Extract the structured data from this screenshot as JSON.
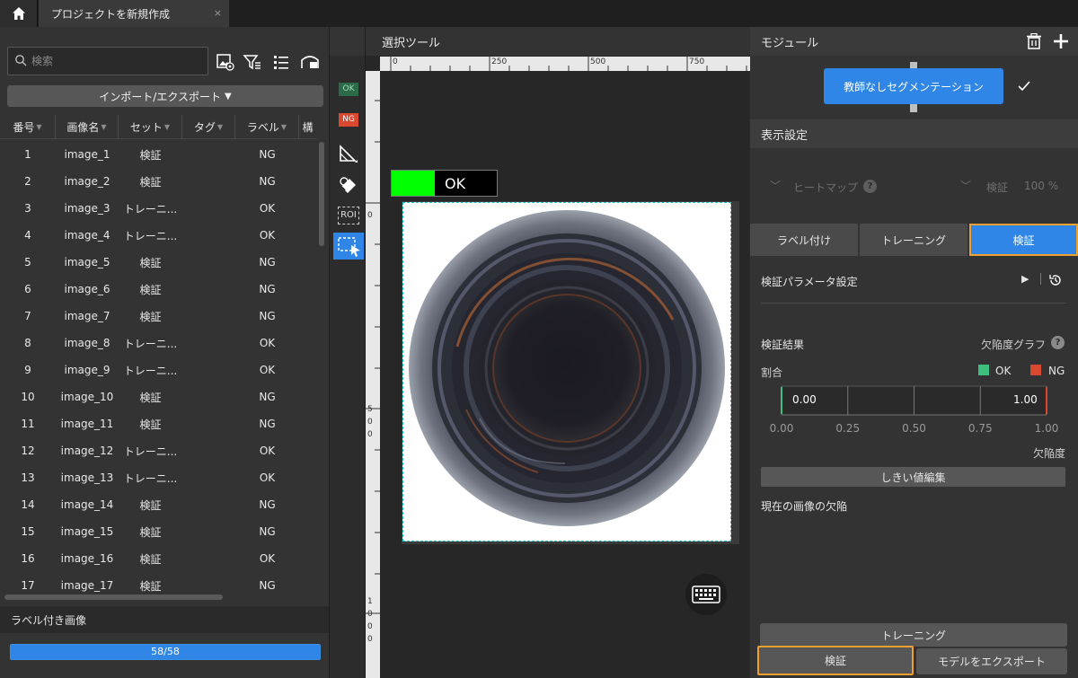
{
  "tab": {
    "title": "プロジェクトを新規作成",
    "close": "×"
  },
  "left": {
    "search_placeholder": "検索",
    "import_label": "インポート/エクスポート",
    "columns": [
      "番号",
      "画像名",
      "セット",
      "タグ",
      "ラベル",
      "構"
    ],
    "rows": [
      {
        "no": "1",
        "name": "image_1",
        "set": "検証",
        "tag": "",
        "label": "NG"
      },
      {
        "no": "2",
        "name": "image_2",
        "set": "検証",
        "tag": "",
        "label": "NG"
      },
      {
        "no": "3",
        "name": "image_3",
        "set": "トレーニ...",
        "tag": "",
        "label": "OK"
      },
      {
        "no": "4",
        "name": "image_4",
        "set": "トレーニ...",
        "tag": "",
        "label": "OK"
      },
      {
        "no": "5",
        "name": "image_5",
        "set": "検証",
        "tag": "",
        "label": "NG"
      },
      {
        "no": "6",
        "name": "image_6",
        "set": "検証",
        "tag": "",
        "label": "NG"
      },
      {
        "no": "7",
        "name": "image_7",
        "set": "検証",
        "tag": "",
        "label": "NG"
      },
      {
        "no": "8",
        "name": "image_8",
        "set": "トレーニ...",
        "tag": "",
        "label": "OK"
      },
      {
        "no": "9",
        "name": "image_9",
        "set": "トレーニ...",
        "tag": "",
        "label": "OK"
      },
      {
        "no": "10",
        "name": "image_10",
        "set": "検証",
        "tag": "",
        "label": "NG"
      },
      {
        "no": "11",
        "name": "image_11",
        "set": "検証",
        "tag": "",
        "label": "NG"
      },
      {
        "no": "12",
        "name": "image_12",
        "set": "トレーニ...",
        "tag": "",
        "label": "OK"
      },
      {
        "no": "13",
        "name": "image_13",
        "set": "トレーニ...",
        "tag": "",
        "label": "OK"
      },
      {
        "no": "14",
        "name": "image_14",
        "set": "検証",
        "tag": "",
        "label": "NG"
      },
      {
        "no": "15",
        "name": "image_15",
        "set": "検証",
        "tag": "",
        "label": "NG"
      },
      {
        "no": "16",
        "name": "image_16",
        "set": "検証",
        "tag": "",
        "label": "OK"
      },
      {
        "no": "17",
        "name": "image_17",
        "set": "検証",
        "tag": "",
        "label": "NG"
      }
    ],
    "labeled_title": "ラベル付き画像",
    "progress_text": "58/58",
    "progress_fraction": 1.0
  },
  "toolstrip": {
    "ok": "OK",
    "ng": "NG",
    "roi": "ROI"
  },
  "canvas": {
    "title": "選択ツール",
    "ruler_h": [
      "0",
      "250",
      "500",
      "750"
    ],
    "ruler_v": [
      "0",
      "5\n0\n0",
      "1\n0\n0\n0"
    ],
    "result_label": "OK",
    "result_color": "#00ff00"
  },
  "right": {
    "module_title": "モジュール",
    "module_name": "教師なしセグメンテーション",
    "display_title": "表示設定",
    "heatmap_label": "ヒートマップ",
    "verify_label": "検証",
    "opacity": "100 %",
    "tabs": [
      "ラベル付け",
      "トレーニング",
      "検証"
    ],
    "params_title": "検証パラメータ設定",
    "result_title": "検証結果",
    "defect_graph_label": "欠陥度グラフ",
    "ratio_label": "割合",
    "legend_ok": "OK",
    "legend_ng": "NG",
    "ok_color": "#3fbf7f",
    "ng_color": "#d9482f",
    "current_defects": "現在の画像の欠陥",
    "threshold_btn": "しきい値編集",
    "train_btn": "トレーニング",
    "verify_btn": "検証",
    "export_btn": "モデルをエクスポート"
  },
  "chart_data": {
    "type": "bar",
    "title": "",
    "xlabel": "欠陥度",
    "ylabel": "",
    "xlim": [
      0.0,
      1.0
    ],
    "x_ticks": [
      "0.00",
      "0.25",
      "0.50",
      "0.75",
      "1.00"
    ],
    "threshold_low": "0.00",
    "threshold_high": "1.00",
    "series": []
  }
}
